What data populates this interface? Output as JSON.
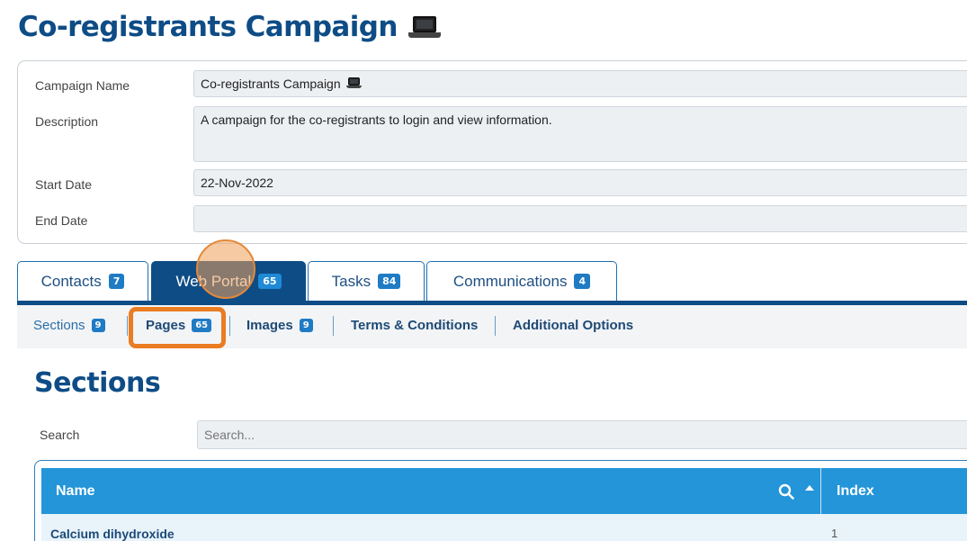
{
  "page": {
    "title": "Co-registrants Campaign"
  },
  "form": {
    "campaign_name_label": "Campaign Name",
    "campaign_name_value": "Co-registrants Campaign",
    "description_label": "Description",
    "description_value": "A campaign for the co-registrants to login and view information.",
    "start_date_label": "Start Date",
    "start_date_value": "22-Nov-2022",
    "end_date_label": "End Date",
    "end_date_value": ""
  },
  "tabs": [
    {
      "label": "Contacts",
      "count": "7"
    },
    {
      "label": "Web Portal",
      "count": "65",
      "active": true
    },
    {
      "label": "Tasks",
      "count": "84"
    },
    {
      "label": "Communications",
      "count": "4"
    }
  ],
  "subnav": [
    {
      "label": "Sections",
      "count": "9",
      "current": true
    },
    {
      "label": "Pages",
      "count": "65",
      "highlighted": true
    },
    {
      "label": "Images",
      "count": "9"
    },
    {
      "label": "Terms & Conditions"
    },
    {
      "label": "Additional Options"
    }
  ],
  "section": {
    "title": "Sections",
    "search_label": "Search",
    "search_placeholder": "Search..."
  },
  "table": {
    "columns": [
      "Name",
      "Index"
    ],
    "rows": [
      {
        "name": "Calcium dihydroxide",
        "index": "1"
      }
    ]
  },
  "icons": {
    "title_icon": "laptop-icon",
    "column_search_icon": "search-icon",
    "column_sort_icon": "sort-asc-icon"
  },
  "colors": {
    "brand": "#0e4c86",
    "accent": "#2395d8",
    "highlight": "#ea7c22"
  }
}
